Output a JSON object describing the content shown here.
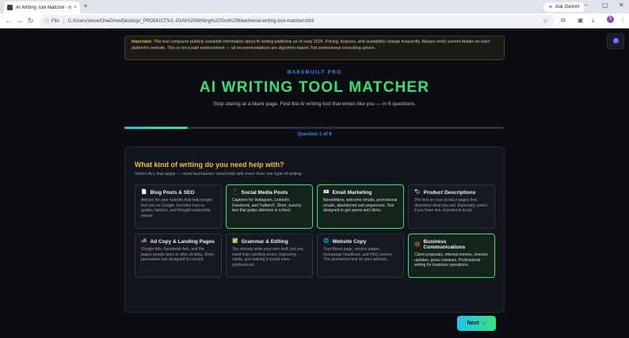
{
  "browser": {
    "tab_title": "AI Writing Tool Matcher - Bake",
    "tab_close": "×",
    "new_tab": "+",
    "gemini_label": "Ask Gemini",
    "file_label": "File",
    "url": "C:/Users/steve/OneDrive/Desktop/_PRODUCTS/1-20/AI%20Writing%20Tool%20Matcher/ai-writing-tool-matcher.html",
    "profile_initial": "S"
  },
  "notice": {
    "label": "Important:",
    "text": " This tool compares publicly available information about AI writing platforms as of early 2026. Pricing, features, and availability change frequently. Always verify current details on each platform's website. This is not a paid endorsement — all recommendations are algorithm-based. Not professional consulting advice."
  },
  "brand": "BAKEBUILT PRO",
  "title": "AI WRITING TOOL MATCHER",
  "tagline": "Stop staring at a blank page. Find the AI writing tool that writes like you — in 6 questions.",
  "progress": {
    "fraction": 0.167,
    "label": "Question 1 of 6"
  },
  "question": {
    "title": "What kind of writing do you need help with?",
    "subtitle": "Select ALL that apply — most businesses need help with more than one type of writing."
  },
  "options": [
    {
      "icon": "📄",
      "icon_name": "document-icon",
      "label": "Blog Posts & SEO",
      "desc": "Articles for your website that help people find you on Google. Includes how-to guides, listicles, and thought leadership pieces.",
      "selected": false
    },
    {
      "icon": "📱",
      "icon_name": "phone-icon",
      "label": "Social Media Posts",
      "desc": "Captions for Instagram, LinkedIn, Facebook, and Twitter/X. Short, punchy text that grabs attention in a feed.",
      "selected": true
    },
    {
      "icon": "📧",
      "icon_name": "email-icon",
      "label": "Email Marketing",
      "desc": "Newsletters, welcome emails, promotional emails, abandoned cart sequences. Text designed to get opens and clicks.",
      "selected": true
    },
    {
      "icon": "🏷",
      "icon_name": "tag-icon",
      "label": "Product Descriptions",
      "desc": "The text on your product pages that describes what you sell. Especially useful if you have lots of products to list.",
      "selected": false
    },
    {
      "icon": "📣",
      "icon_name": "megaphone-icon",
      "label": "Ad Copy & Landing Pages",
      "desc": "Google Ads, Facebook Ads, and the pages people land on after clicking. Short, persuasive text designed to convert.",
      "selected": false
    },
    {
      "icon": "✅",
      "icon_name": "checkmark-icon",
      "label": "Grammar & Editing",
      "desc": "You already write your own stuff, but you need help catching errors, improving clarity, and making it sound more professional.",
      "selected": false
    },
    {
      "icon": "🌐",
      "icon_name": "globe-icon",
      "label": "Website Copy",
      "desc": "Your About page, service pages, homepage headlines, and FAQ section. The permanent text on your website.",
      "selected": false
    },
    {
      "icon": "💼",
      "icon_name": "briefcase-icon",
      "label": "Business Communications",
      "desc": "Client proposals, internal memos, investor updates, press releases. Professional writing for business operations.",
      "selected": true
    }
  ],
  "next_label": "Next →",
  "colors": {
    "accent_green": "#39e07a",
    "accent_blue": "#3a8df2",
    "heading_gold": "#e8c04a",
    "background": "#0b0d12"
  }
}
